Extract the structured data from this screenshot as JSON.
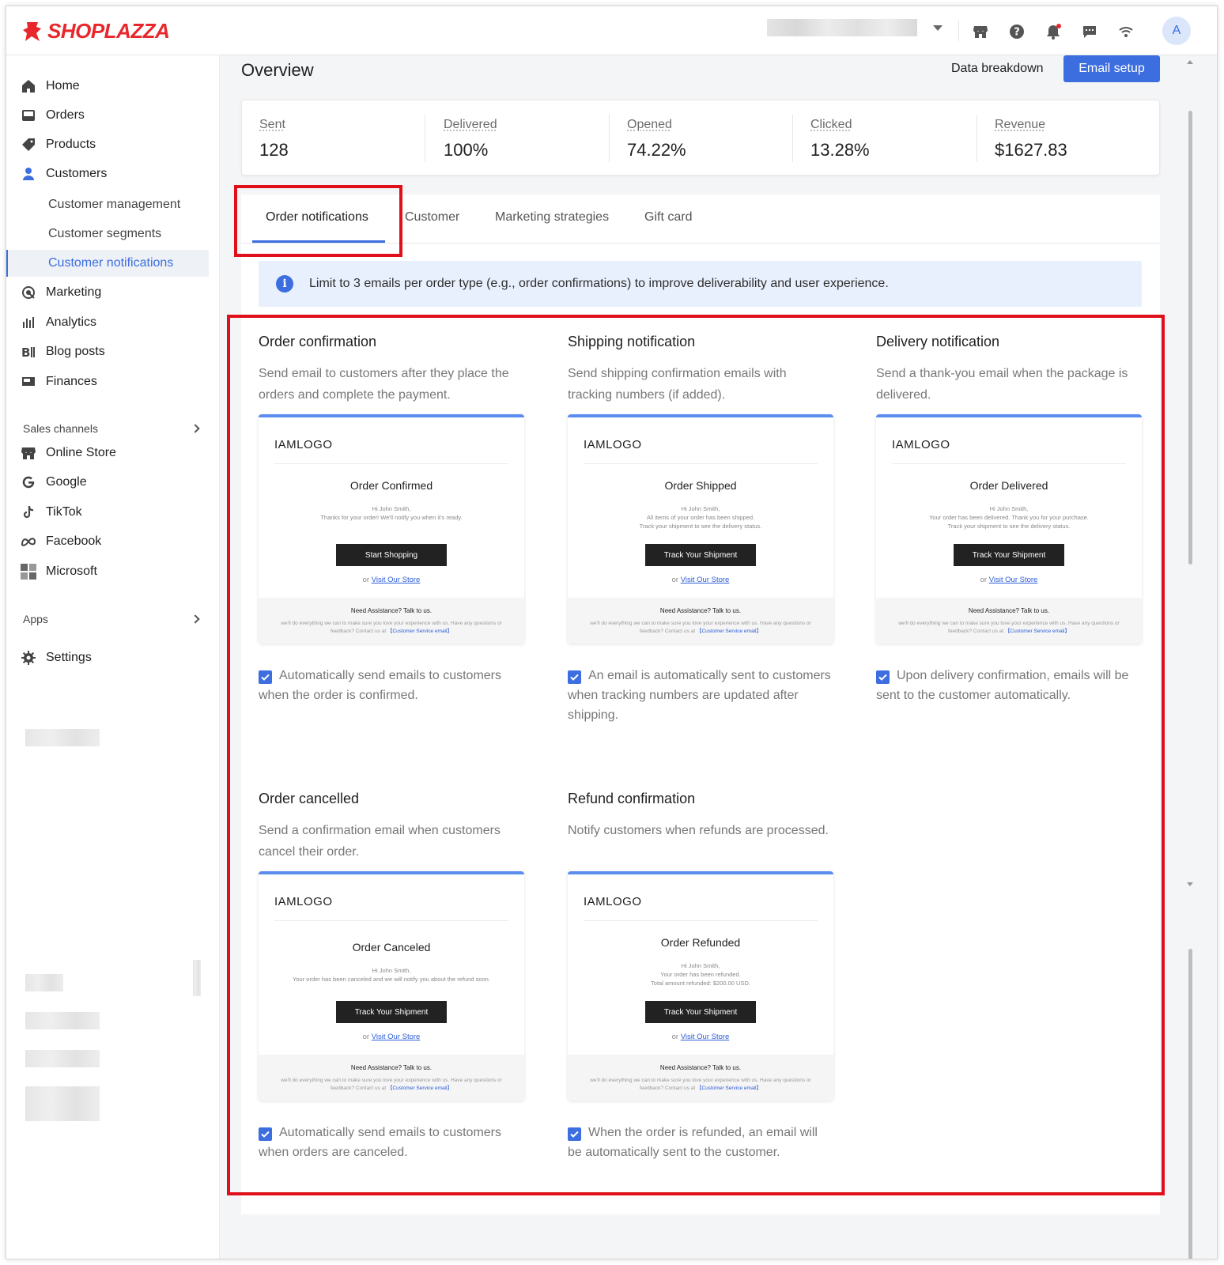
{
  "brand": {
    "name": "SHOPLAZZA",
    "color": "#e8272c"
  },
  "topbar": {
    "icons": [
      "store-icon",
      "help-icon",
      "bell-icon",
      "chat-icon",
      "wifi-icon"
    ],
    "avatar_initial": "A"
  },
  "sidebar": {
    "items": [
      {
        "label": "Home",
        "icon": "home-icon"
      },
      {
        "label": "Orders",
        "icon": "orders-icon"
      },
      {
        "label": "Products",
        "icon": "tag-icon"
      },
      {
        "label": "Customers",
        "icon": "person-icon"
      }
    ],
    "customer_subitems": [
      {
        "label": "Customer management"
      },
      {
        "label": "Customer segments"
      },
      {
        "label": "Customer notifications",
        "active": true
      }
    ],
    "items_after": [
      {
        "label": "Marketing",
        "icon": "marketing-icon"
      },
      {
        "label": "Analytics",
        "icon": "bar-chart-icon"
      },
      {
        "label": "Blog posts",
        "icon": "blog-icon"
      },
      {
        "label": "Finances",
        "icon": "finance-icon"
      }
    ],
    "sales_channels_label": "Sales channels",
    "channels": [
      {
        "label": "Online Store",
        "icon": "store-icon"
      },
      {
        "label": "Google",
        "icon": "google-icon"
      },
      {
        "label": "TikTok",
        "icon": "tiktok-icon"
      },
      {
        "label": "Facebook",
        "icon": "meta-icon"
      },
      {
        "label": "Microsoft",
        "icon": "microsoft-icon"
      }
    ],
    "apps_label": "Apps",
    "settings_label": "Settings"
  },
  "header": {
    "title": "Overview",
    "data_breakdown": "Data breakdown",
    "email_setup": "Email setup"
  },
  "stats": [
    {
      "label": "Sent",
      "value": "128"
    },
    {
      "label": "Delivered",
      "value": "100%"
    },
    {
      "label": "Opened",
      "value": "74.22%"
    },
    {
      "label": "Clicked",
      "value": "13.28%"
    },
    {
      "label": "Revenue",
      "value": "$1627.83"
    }
  ],
  "tabs": [
    {
      "label": "Order notifications",
      "active": true
    },
    {
      "label": "Customer"
    },
    {
      "label": "Marketing strategies"
    },
    {
      "label": "Gift card"
    }
  ],
  "info_banner": "Limit to 3 emails per order type (e.g., order confirmations) to improve deliverability and user experience.",
  "preview_common": {
    "logo": "IAMLOGO",
    "greeting": "Hi John Smith,",
    "or": "or",
    "visit_store": "Visit Our Store",
    "footer_title": "Need Assistance? Talk to us.",
    "footer_text": "we'll do everything we can to make sure you love your experience with us. Have any questions or feedback? Contact us at",
    "footer_link": "【Customer Service email】"
  },
  "cards": [
    {
      "title": "Order confirmation",
      "description": "Send email to customers after they place the orders and complete the payment.",
      "preview_heading": "Order Confirmed",
      "preview_lines": [
        "Thanks for your order! We'll notify you when it's ready."
      ],
      "preview_button": "Start Shopping",
      "auto_text": "Automatically send emails to customers when the order is confirmed."
    },
    {
      "title": "Shipping notification",
      "description": "Send shipping confirmation emails with tracking numbers (if added).",
      "preview_heading": "Order Shipped",
      "preview_lines": [
        "All items of your order has been shipped.",
        "Track your shipment to see the delivery status."
      ],
      "preview_button": "Track Your Shipment",
      "auto_text": "An email is automatically sent to customers when tracking numbers are updated after shipping."
    },
    {
      "title": "Delivery notification",
      "description": "Send a thank-you email when the package is delivered.",
      "preview_heading": "Order Delivered",
      "preview_lines": [
        "Your order has been delivered. Thank you for your purchase.",
        "Track your shipment to see the delivery status."
      ],
      "preview_button": "Track Your Shipment",
      "auto_text": "Upon delivery confirmation, emails will be sent to the customer automatically."
    },
    {
      "title": "Order cancelled",
      "description": "Send a confirmation email when customers cancel their order.",
      "preview_heading": "Order Canceled",
      "preview_lines": [
        "Your order has been canceled and we will notify you about the refund soon."
      ],
      "preview_button": "Track Your Shipment",
      "auto_text": "Automatically send emails to customers when orders are canceled."
    },
    {
      "title": "Refund confirmation",
      "description": "Notify customers when refunds are processed.",
      "preview_heading": "Order Refunded",
      "preview_lines": [
        "Your order has been refunded.",
        "Total amount refunded: $200.00 USD."
      ],
      "preview_button": "Track Your Shipment",
      "auto_text": "When the order is refunded, an email will be automatically sent to the customer."
    }
  ],
  "colors": {
    "accent": "#3c6ee0",
    "highlight": "#e0101b",
    "banner": "#e9f0fd"
  }
}
